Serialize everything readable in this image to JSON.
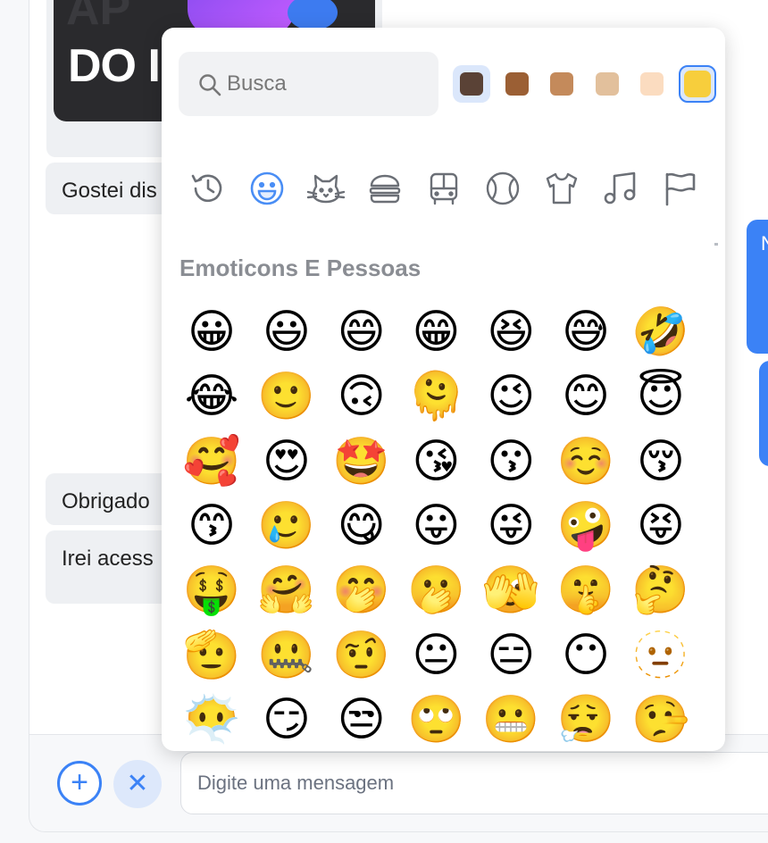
{
  "background": {
    "thumbnail_text": "DO IN",
    "thumbnail_ghost_text": "AP",
    "incoming_messages": [
      "Gostei dis",
      "Obrigado",
      "Irei acess"
    ],
    "outgoing_messages": [
      "N",
      ""
    ]
  },
  "composer": {
    "add_label": "+",
    "close_label": "✕",
    "input_placeholder": "Digite uma mensagem"
  },
  "picker": {
    "search_placeholder": "Busca",
    "skin_tones": [
      "#5a4236",
      "#9b5f34",
      "#c48a5b",
      "#e2c09c",
      "#fbdcc0",
      "#f7ce3c"
    ],
    "selected_tone_index": 5,
    "categories": [
      {
        "name": "recent",
        "icon": "clock-icon"
      },
      {
        "name": "smileys",
        "icon": "smiley-icon",
        "active": true
      },
      {
        "name": "animals",
        "icon": "cat-icon"
      },
      {
        "name": "food",
        "icon": "burger-icon"
      },
      {
        "name": "travel",
        "icon": "bus-icon"
      },
      {
        "name": "activities",
        "icon": "ball-icon"
      },
      {
        "name": "objects",
        "icon": "shirt-icon"
      },
      {
        "name": "symbols",
        "icon": "music-icon"
      },
      {
        "name": "flags",
        "icon": "flag-icon"
      }
    ],
    "category_title": "Emoticons E Pessoas",
    "emoji_rows": [
      [
        "😀",
        "😃",
        "😄",
        "😁",
        "😆",
        "😅",
        "🤣"
      ],
      [
        "😂",
        "🙂",
        "🙃",
        "🫠",
        "😉",
        "😊",
        "😇"
      ],
      [
        "🥰",
        "😍",
        "🤩",
        "😘",
        "😗",
        "☺️",
        "😚"
      ],
      [
        "😙",
        "🥲",
        "😋",
        "😛",
        "😜",
        "🤪",
        "😝"
      ],
      [
        "🤑",
        "🤗",
        "🤭",
        "🫢",
        "🫣",
        "🤫",
        "🤔"
      ],
      [
        "🫡",
        "🤐",
        "🤨",
        "😐",
        "😑",
        "😶",
        "🫥"
      ],
      [
        "😶‍🌫️",
        "😏",
        "😒",
        "🙄",
        "😬",
        "😮‍💨",
        "🤥"
      ]
    ],
    "accent_color": "#3b82f6"
  }
}
